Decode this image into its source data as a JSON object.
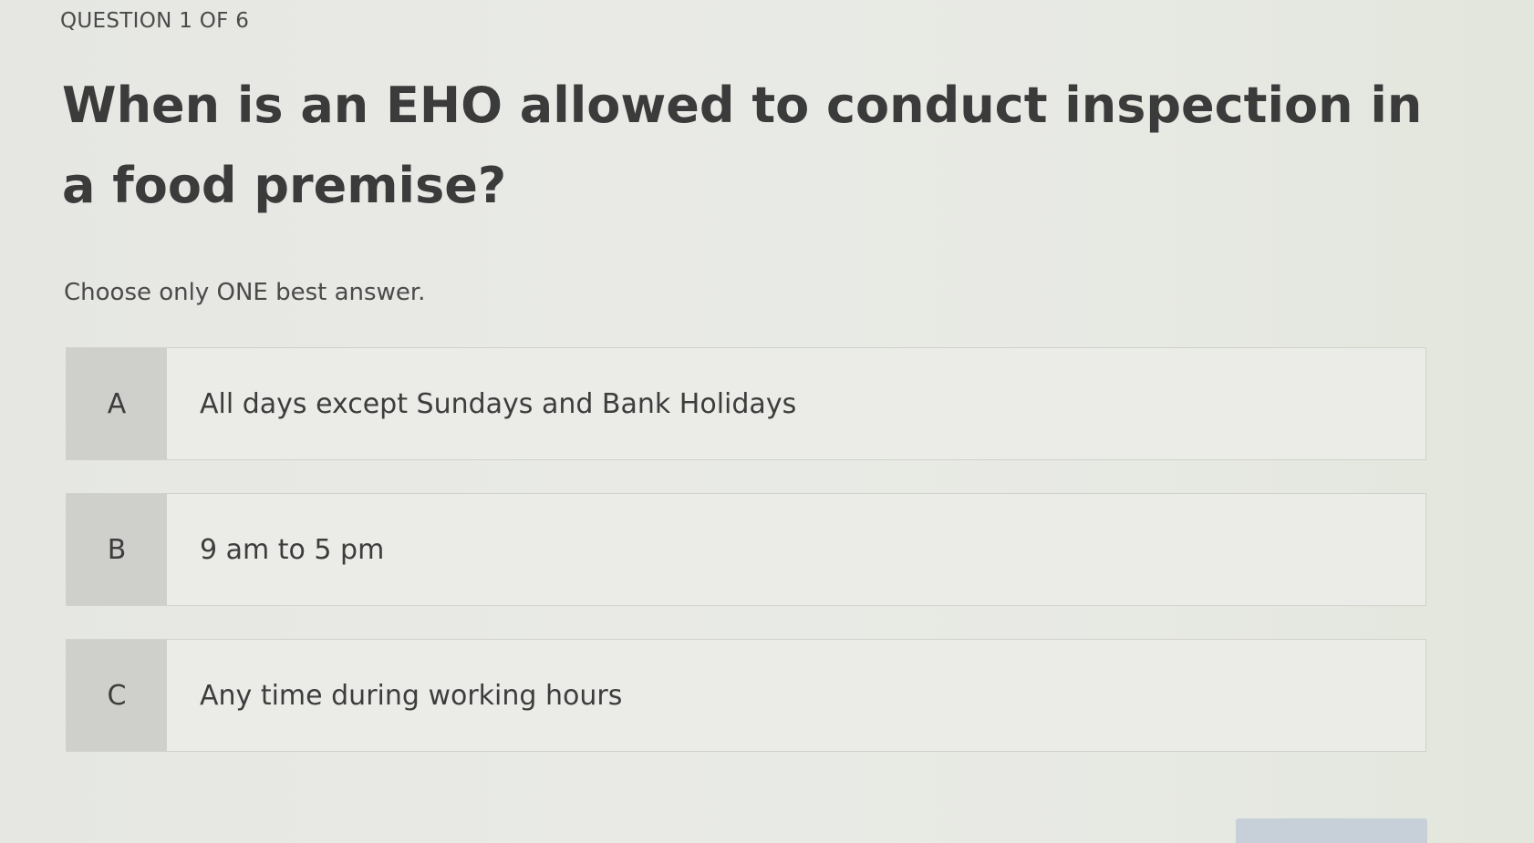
{
  "question": {
    "counter": "QUESTION 1 OF 6",
    "text": "When is an EHO allowed to conduct inspection in a food premise?",
    "instructions": "Choose only ONE best answer."
  },
  "options": [
    {
      "letter": "A",
      "text": "All days except Sundays and Bank Holidays"
    },
    {
      "letter": "B",
      "text": "9 am to 5 pm"
    },
    {
      "letter": "C",
      "text": "Any time during working hours"
    }
  ]
}
